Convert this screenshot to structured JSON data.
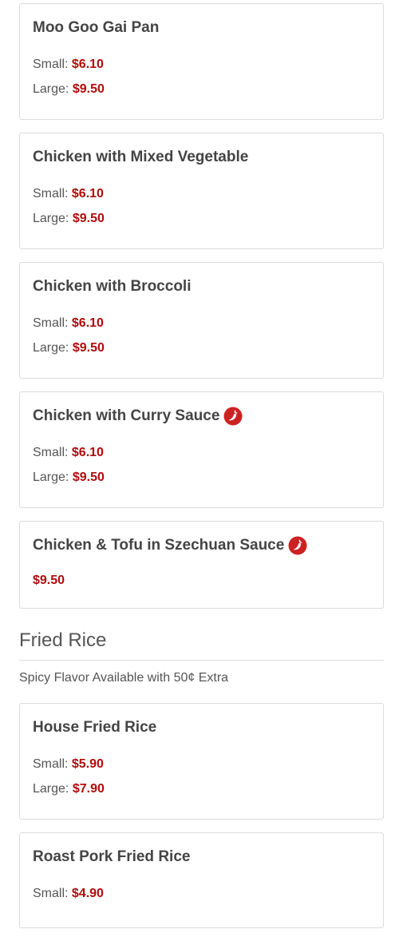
{
  "colors": {
    "price": "#b00b0b",
    "text": "#555555",
    "title": "#444444",
    "border": "#dcdcdc",
    "pepper": "#cc2222"
  },
  "icons": {
    "spicy": "chili-pepper-icon"
  },
  "items_group_1": [
    {
      "name": "Moo Goo Gai Pan",
      "spicy": false,
      "small_label": "Small:",
      "small_price": "$6.10",
      "large_label": "Large:",
      "large_price": "$9.50"
    },
    {
      "name": "Chicken with Mixed Vegetable",
      "spicy": false,
      "small_label": "Small:",
      "small_price": "$6.10",
      "large_label": "Large:",
      "large_price": "$9.50"
    },
    {
      "name": "Chicken with Broccoli",
      "spicy": false,
      "small_label": "Small:",
      "small_price": "$6.10",
      "large_label": "Large:",
      "large_price": "$9.50"
    },
    {
      "name": "Chicken with Curry Sauce",
      "spicy": true,
      "small_label": "Small:",
      "small_price": "$6.10",
      "large_label": "Large:",
      "large_price": "$9.50"
    },
    {
      "name": "Chicken & Tofu in Szechuan Sauce",
      "spicy": true,
      "price": "$9.50"
    }
  ],
  "fried_rice": {
    "title": "Fried Rice",
    "note": "Spicy Flavor Available with 50¢ Extra",
    "items": [
      {
        "name": "House Fried Rice",
        "small_label": "Small:",
        "small_price": "$5.90",
        "large_label": "Large:",
        "large_price": "$7.90"
      },
      {
        "name": "Roast Pork Fried Rice",
        "small_label": "Small:",
        "small_price": "$4.90"
      }
    ]
  }
}
